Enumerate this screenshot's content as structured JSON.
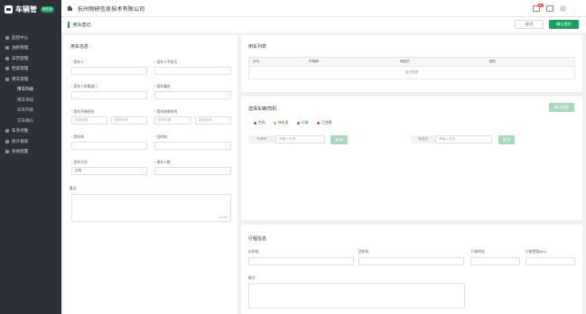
{
  "app": {
    "name": "车辆管",
    "badge": "商业版"
  },
  "header": {
    "company": "杭州物研信息技术有限公司",
    "notice_count": "99+"
  },
  "sidebar": {
    "items": [
      {
        "label": "监控中心",
        "sub": false
      },
      {
        "label": "油耗管理",
        "sub": false
      },
      {
        "label": "日历管理",
        "sub": false
      },
      {
        "label": "档案管理",
        "sub": false
      },
      {
        "label": "用车管理",
        "sub": false
      },
      {
        "label": "用车列表",
        "sub": true
      },
      {
        "label": "用车审核",
        "sub": true
      },
      {
        "label": "派车列表",
        "sub": true
      },
      {
        "label": "交车确认",
        "sub": true
      },
      {
        "label": "车务考勤",
        "sub": false
      },
      {
        "label": "统计报表",
        "sub": false
      },
      {
        "label": "系统配置",
        "sub": false
      }
    ]
  },
  "page": {
    "title": "用车登记",
    "cancel_label": "取消",
    "confirm_label": "确认提交"
  },
  "form": {
    "title": "用车信息",
    "fields": {
      "applicant": "用车人",
      "phone": "用车人手机号",
      "department": "用车人所属部门",
      "reason": "用车事由",
      "start_time": "用车开始时间",
      "end_time": "用车结束时间",
      "start_date_ph": "选择日期",
      "start_time_ph": "选择时间",
      "end_date_ph": "选择日期",
      "end_time_ph": "选择时间",
      "origin": "用车地",
      "destination": "目的地",
      "method": "用车方式",
      "method_value": "自驾",
      "passengers": "乘车人数",
      "remark": "备注",
      "remark_count": "0/200"
    }
  },
  "vehicle_list": {
    "title": "用车列表",
    "columns": [
      "序号",
      "车辆牌",
      "驾驶员",
      "操作"
    ],
    "empty": "暂无数据"
  },
  "select_vehicle": {
    "title": "选择车辆/司机",
    "confirm_label": "确认选择",
    "status": [
      {
        "label": "空闲",
        "color": "#1aa05c"
      },
      {
        "label": "待出发",
        "color": "#e8a33c"
      },
      {
        "label": "行驶",
        "color": "#3c8de8"
      },
      {
        "label": "已违章",
        "color": "#e84a4a"
      }
    ],
    "plate_label": "车牌号",
    "plate_ph": "请输入车牌",
    "query_label": "查询",
    "driver_label": "驾驶员",
    "driver_ph": "请输入司机",
    "query2_label": "查询"
  },
  "trip": {
    "title": "行程信息",
    "mileage_start": "出车码",
    "mileage_end": "回车码",
    "duration": "行驶时长",
    "distance": "行驶里程(km)",
    "remark": "备注"
  }
}
